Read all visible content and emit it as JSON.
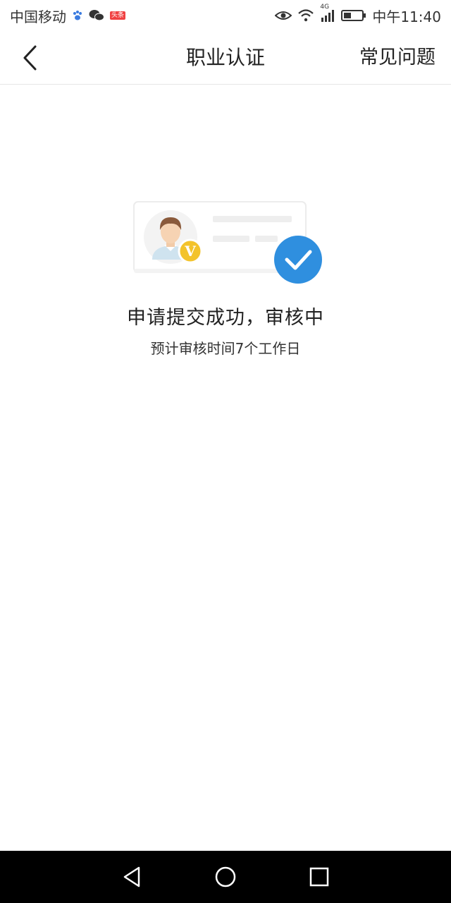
{
  "status_bar": {
    "carrier": "中国移动",
    "toutiao_label": "头条",
    "network": "4G",
    "time": "中午11:40",
    "icons": [
      "baidu-paw-icon",
      "wechat-icon",
      "toutiao-icon",
      "eye-icon",
      "wifi-icon",
      "signal-icon",
      "battery-icon"
    ]
  },
  "nav": {
    "title": "职业认证",
    "faq_label": "常见问题",
    "back_icon": "chevron-left-icon"
  },
  "content": {
    "title": "申请提交成功，审核中",
    "subtitle": "预计审核时间7个工作日",
    "badge_letter": "V",
    "colors": {
      "check_blue": "#2f8fdf",
      "badge_yellow": "#f3c32b"
    }
  },
  "android_nav": {
    "icons": [
      "back-triangle-icon",
      "home-circle-icon",
      "recents-square-icon"
    ]
  }
}
